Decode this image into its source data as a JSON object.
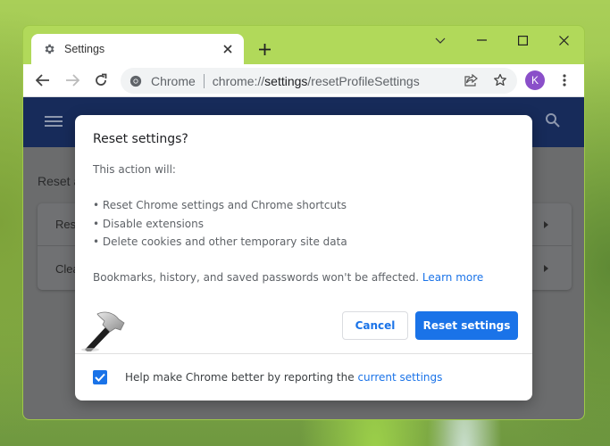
{
  "window": {
    "tab": {
      "title": "Settings",
      "icon": "gear-icon"
    },
    "new_tab_icon": "plus-icon",
    "controls": {
      "tab_search": "chevron-down-icon",
      "minimize": "minimize-icon",
      "maximize": "maximize-icon",
      "close": "close-icon"
    }
  },
  "toolbar": {
    "back_icon": "arrow-left-icon",
    "forward_icon": "arrow-right-icon",
    "reload_icon": "reload-icon",
    "omnibox": {
      "site_label": "Chrome",
      "url_scheme": "chrome://",
      "url_host": "settings",
      "url_path": "/resetProfileSettings"
    },
    "share_icon": "share-icon",
    "bookmark_icon": "star-icon",
    "profile_initial": "K",
    "menu_icon": "more-vert-icon"
  },
  "settings_page": {
    "header": {
      "menu_icon": "hamburger-icon",
      "search_icon": "search-icon"
    },
    "section_heading": "Reset and clean up",
    "rows": [
      {
        "label": "Restore settings to their original defaults"
      },
      {
        "label": "Clean up computer"
      }
    ]
  },
  "dialog": {
    "title": "Reset settings?",
    "intro": "This action will:",
    "bullets": [
      "• Reset Chrome settings and Chrome shortcuts",
      "• Disable extensions",
      "• Delete cookies and other temporary site data"
    ],
    "note": "Bookmarks, history, and saved passwords won't be affected.",
    "learn_more": "Learn more",
    "cancel_label": "Cancel",
    "reset_label": "Reset settings",
    "footer": {
      "checkbox_checked": true,
      "text": "Help make Chrome better by reporting the",
      "link": "current settings"
    }
  },
  "colors": {
    "accent": "#1a73e8",
    "header_bg": "#172b5a",
    "frame": "#b1d95a",
    "avatar": "#8a4fc9"
  }
}
